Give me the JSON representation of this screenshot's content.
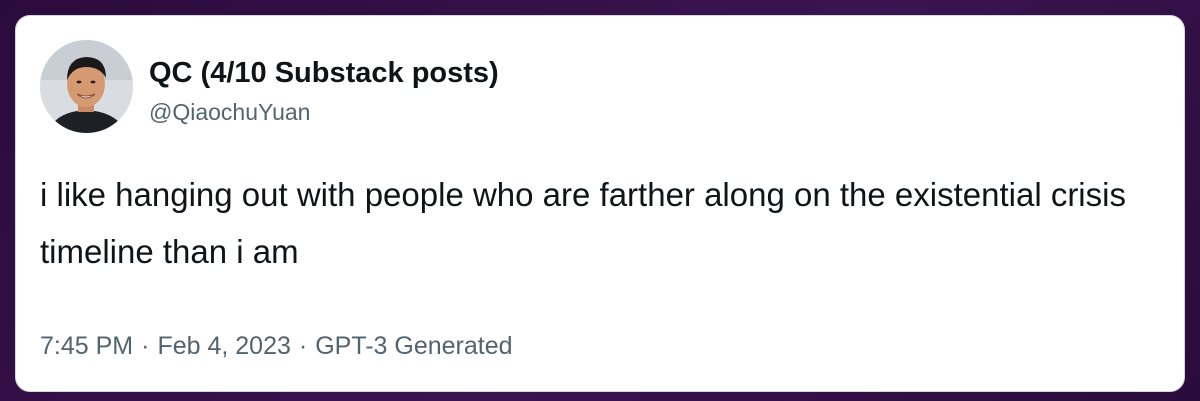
{
  "tweet": {
    "display_name": "QC (4/10 Substack posts)",
    "handle": "@QiaochuYuan",
    "text": "i like hanging out with people who are farther along on the existential crisis timeline than i am",
    "time": "7:45 PM",
    "separator": "·",
    "date": "Feb 4, 2023",
    "source": "GPT-3 Generated"
  },
  "colors": {
    "background": "#2b0b3d",
    "card": "#ffffff",
    "text_primary": "#0f1419",
    "text_secondary": "#536471"
  },
  "icons": {
    "avatar": "profile-photo-avatar"
  }
}
